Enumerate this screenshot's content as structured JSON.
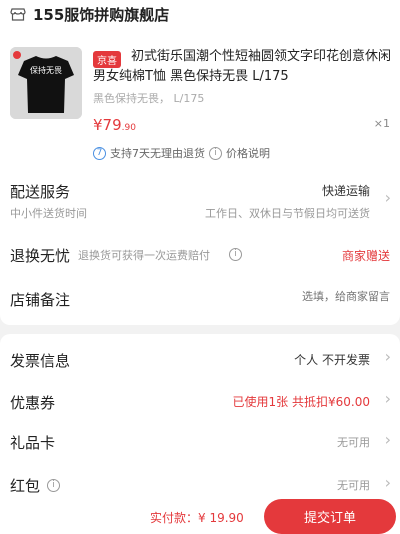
{
  "shop": {
    "name": "155服饰拼购旗舰店",
    "icon": "store-icon"
  },
  "product": {
    "badge": "京喜",
    "title": "初式街乐国潮个性短袖圆领文字印花创意休闲男女纯棉T恤 黑色保持无畏 L/175",
    "spec": "黑色保持无畏， L/175",
    "price_symbol": "¥",
    "price_int": "79",
    "price_dec": ".90",
    "quantity": "×1",
    "service_return": "支持7天无理由退货",
    "service_price": "价格说明",
    "thumb_text": "保持无畏"
  },
  "delivery": {
    "label": "配送服务",
    "sub": "中小件送货时间",
    "method": "快递运输",
    "time": "工作日、双休日与节假日均可送货"
  },
  "return_service": {
    "label": "退换无忧",
    "desc": "退换货可获得一次运费赔付",
    "value": "商家赠送"
  },
  "remark": {
    "label": "店铺备注",
    "placeholder": "选填，给商家留言"
  },
  "invoice": {
    "label": "发票信息",
    "value": "个人 不开发票"
  },
  "coupon": {
    "label": "优惠券",
    "value": "已使用1张 共抵扣¥60.00"
  },
  "giftcard": {
    "label": "礼品卡",
    "value": "无可用"
  },
  "redpacket": {
    "label": "红包",
    "value": "无可用"
  },
  "bottom": {
    "pay_label": "实付款：¥ 19.90",
    "submit": "提交订单"
  },
  "colors": {
    "accent": "#e4393c",
    "info": "#4a90e2"
  }
}
